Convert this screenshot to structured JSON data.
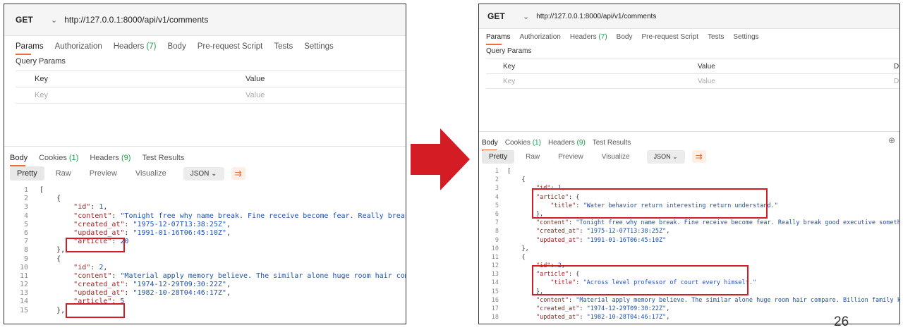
{
  "request": {
    "method": "GET",
    "url": "http://127.0.0.1:8000/api/v1/comments",
    "tabs": [
      {
        "label": "Params",
        "count": ""
      },
      {
        "label": "Authorization",
        "count": ""
      },
      {
        "label": "Headers",
        "count": "(7)"
      },
      {
        "label": "Body",
        "count": ""
      },
      {
        "label": "Pre-request Script",
        "count": ""
      },
      {
        "label": "Tests",
        "count": ""
      },
      {
        "label": "Settings",
        "count": ""
      }
    ],
    "query_params_title": "Query Params",
    "table_headers": {
      "key": "Key",
      "value": "Value"
    },
    "placeholders": {
      "key": "Key",
      "value": "Value"
    },
    "right_cut_col": "D"
  },
  "response": {
    "tabs": [
      {
        "label": "Body",
        "count": ""
      },
      {
        "label": "Cookies",
        "count": "(1)"
      },
      {
        "label": "Headers",
        "count": "(9)"
      },
      {
        "label": "Test Results",
        "count": ""
      }
    ],
    "formats": [
      "Pretty",
      "Raw",
      "Preview",
      "Visualize"
    ],
    "json_select": "JSON",
    "globe_icon": "globe-icon"
  },
  "left_code": [
    {
      "n": "1",
      "t": "["
    },
    {
      "n": "2",
      "t": "    {"
    },
    {
      "n": "3",
      "t": "        \"id\": 1,"
    },
    {
      "n": "4",
      "t": "        \"content\": \"Tonight free why name break. Fine receive become fear. Really break good executive something imp"
    },
    {
      "n": "5",
      "t": "        \"created_at\": \"1975-12-07T13:38:25Z\","
    },
    {
      "n": "6",
      "t": "        \"updated_at\": \"1991-01-16T06:45:10Z\","
    },
    {
      "n": "7",
      "t": "        \"article\": 20"
    },
    {
      "n": "8",
      "t": "    },"
    },
    {
      "n": "9",
      "t": "    {"
    },
    {
      "n": "10",
      "t": "        \"id\": 2,"
    },
    {
      "n": "11",
      "t": "        \"content\": \"Material apply memory believe. The similar alone huge room hair compare. Billion family kitchen"
    },
    {
      "n": "12",
      "t": "        \"created_at\": \"1974-12-29T09:30:22Z\","
    },
    {
      "n": "13",
      "t": "        \"updated_at\": \"1982-10-28T04:46:17Z\","
    },
    {
      "n": "14",
      "t": "        \"article\": 5"
    },
    {
      "n": "15",
      "t": "    },"
    }
  ],
  "right_code": [
    {
      "n": "1",
      "t": "["
    },
    {
      "n": "2",
      "t": "    {"
    },
    {
      "n": "3",
      "t": "        \"id\": 1,"
    },
    {
      "n": "4",
      "t": "        \"article\": {"
    },
    {
      "n": "5",
      "t": "            \"title\": \"Water behavior return interesting return understand.\""
    },
    {
      "n": "6",
      "t": "        },"
    },
    {
      "n": "7",
      "t": "        \"content\": \"Tonight free why name break. Fine receive become fear. Really break good executive something imp"
    },
    {
      "n": "8",
      "t": "        \"created_at\": \"1975-12-07T13:38:25Z\","
    },
    {
      "n": "9",
      "t": "        \"updated_at\": \"1991-01-16T06:45:10Z\""
    },
    {
      "n": "10",
      "t": "    },"
    },
    {
      "n": "11",
      "t": "    {"
    },
    {
      "n": "12",
      "t": "        \"id\": 2,"
    },
    {
      "n": "13",
      "t": "        \"article\": {"
    },
    {
      "n": "14",
      "t": "            \"title\": \"Across level professor of court every himself.\""
    },
    {
      "n": "15",
      "t": "        },"
    },
    {
      "n": "16",
      "t": "        \"content\": \"Material apply memory believe. The similar alone huge room hair compare. Billion family kitchen"
    },
    {
      "n": "17",
      "t": "        \"created_at\": \"1974-12-29T09:30:22Z\","
    },
    {
      "n": "18",
      "t": "        \"updated_at\": \"1982-10-28T04:46:17Z\","
    }
  ],
  "arrow_icon": "right-arrow-icon",
  "arrow_color": "#d41c24",
  "accent_color": "#f26b3a",
  "count_color": "#1e9e4a",
  "page_number": "26"
}
